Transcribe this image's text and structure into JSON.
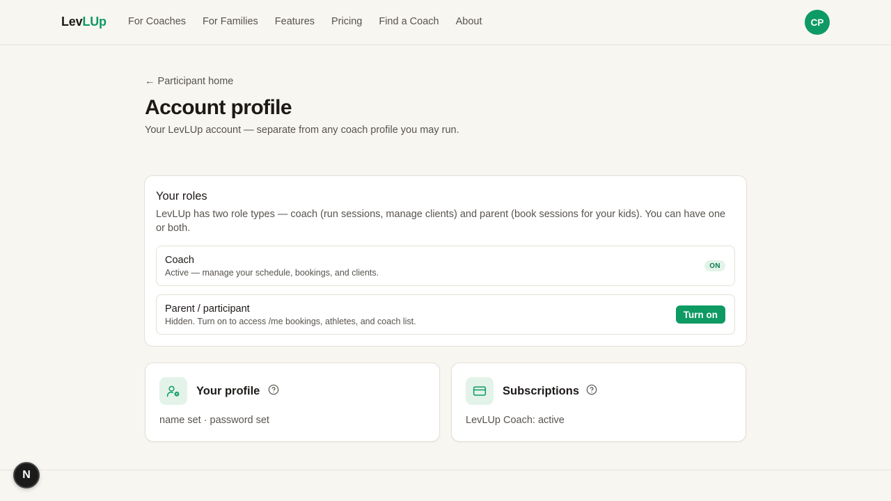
{
  "header": {
    "logo_part1": "Lev",
    "logo_part2": "LUp",
    "nav": [
      "For Coaches",
      "For Families",
      "Features",
      "Pricing",
      "Find a Coach",
      "About"
    ],
    "avatar_initials": "CP"
  },
  "page": {
    "back_link": "← Participant home",
    "title": "Account profile",
    "subtitle": "Your LevLUp account — separate from any coach profile you may run."
  },
  "roles": {
    "title": "Your roles",
    "description": "LevLUp has two role types — coach (run sessions, manage clients) and parent (book sessions for your kids). You can have one or both.",
    "items": [
      {
        "name": "Coach",
        "description": "Active — manage your schedule, bookings, and clients.",
        "status": "ON"
      },
      {
        "name": "Parent / participant",
        "description": "Hidden. Turn on to access /me bookings, athletes, and coach list.",
        "action": "Turn on"
      }
    ]
  },
  "cards": {
    "profile": {
      "title": "Your profile",
      "status": "name set · password set",
      "icon": "user-gear-icon"
    },
    "subscriptions": {
      "title": "Subscriptions",
      "status": "LevLUp Coach: active",
      "icon": "credit-card-icon"
    }
  },
  "dev_badge": "N",
  "colors": {
    "brand": "#0e9a63",
    "background": "#f8f6f1"
  }
}
